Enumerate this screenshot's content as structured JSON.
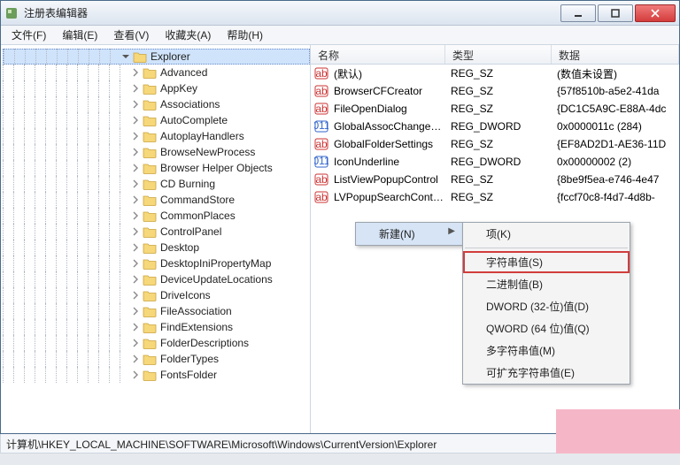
{
  "window": {
    "title": "注册表编辑器"
  },
  "menus": {
    "file": "文件(F)",
    "edit": "编辑(E)",
    "view": "查看(V)",
    "fav": "收藏夹(A)",
    "help": "帮助(H)"
  },
  "tree": {
    "expanded_label": "Explorer",
    "items": [
      "Advanced",
      "AppKey",
      "Associations",
      "AutoComplete",
      "AutoplayHandlers",
      "BrowseNewProcess",
      "Browser Helper Objects",
      "CD Burning",
      "CommandStore",
      "CommonPlaces",
      "ControlPanel",
      "Desktop",
      "DesktopIniPropertyMap",
      "DeviceUpdateLocations",
      "DriveIcons",
      "FileAssociation",
      "FindExtensions",
      "FolderDescriptions",
      "FolderTypes",
      "FontsFolder"
    ]
  },
  "columns": {
    "name": "名称",
    "type": "类型",
    "data": "数据"
  },
  "values": [
    {
      "icon": "ab",
      "name": "(默认)",
      "type": "REG_SZ",
      "data": "(数值未设置)"
    },
    {
      "icon": "ab",
      "name": "BrowserCFCreator",
      "type": "REG_SZ",
      "data": "{57f8510b-a5e2-41da"
    },
    {
      "icon": "ab",
      "name": "FileOpenDialog",
      "type": "REG_SZ",
      "data": "{DC1C5A9C-E88A-4dc"
    },
    {
      "icon": "dw",
      "name": "GlobalAssocChanged...",
      "type": "REG_DWORD",
      "data": "0x0000011c (284)"
    },
    {
      "icon": "ab",
      "name": "GlobalFolderSettings",
      "type": "REG_SZ",
      "data": "{EF8AD2D1-AE36-11D"
    },
    {
      "icon": "dw",
      "name": "IconUnderline",
      "type": "REG_DWORD",
      "data": "0x00000002 (2)"
    },
    {
      "icon": "ab",
      "name": "ListViewPopupControl",
      "type": "REG_SZ",
      "data": "{8be9f5ea-e746-4e47"
    },
    {
      "icon": "ab",
      "name": "LVPopupSearchControl",
      "type": "REG_SZ",
      "data": "{fccf70c8-f4d7-4d8b-"
    }
  ],
  "context": {
    "new": "新建(N)",
    "submenu": {
      "key": "项(K)",
      "string": "字符串值(S)",
      "binary": "二进制值(B)",
      "dword32": "DWORD (32-位)值(D)",
      "qword64": "QWORD (64 位)值(Q)",
      "multistr": "多字符串值(M)",
      "expstr": "可扩充字符串值(E)"
    }
  },
  "status": "计算机\\HKEY_LOCAL_MACHINE\\SOFTWARE\\Microsoft\\Windows\\CurrentVersion\\Explorer"
}
